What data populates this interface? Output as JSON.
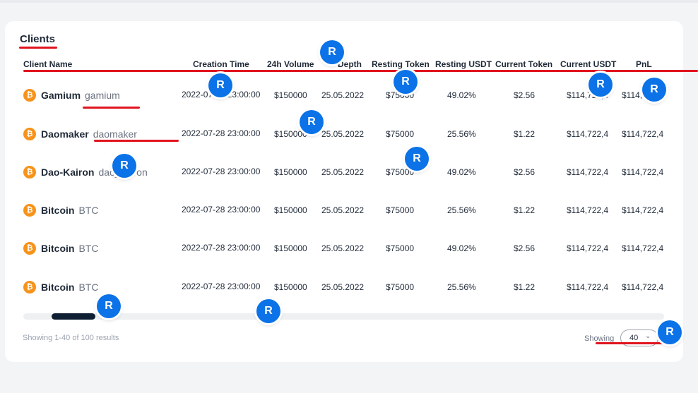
{
  "section": {
    "title": "Clients"
  },
  "columns": [
    "Client Name",
    "Creation Time",
    "24h Volume",
    "Depth",
    "Resting Token",
    "Resting USDT",
    "Current Token",
    "Current USDT",
    "PnL"
  ],
  "rows": [
    {
      "name": "Gamium",
      "symbol": "gamium",
      "created": "2022-07-28 23:00:00",
      "volume": "$150000",
      "depth": "25.05.2022",
      "resting_token": "$75000",
      "resting_usdt": "49.02%",
      "current_token": "$2.56",
      "current_usdt": "$114,722,4",
      "pnl": "$114,722,4"
    },
    {
      "name": "Daomaker",
      "symbol": "daomaker",
      "created": "2022-07-28 23:00:00",
      "volume": "$150000",
      "depth": "25.05.2022",
      "resting_token": "$75000",
      "resting_usdt": "25.56%",
      "current_token": "$1.22",
      "current_usdt": "$114,722,4",
      "pnl": "$114,722,4"
    },
    {
      "name": "Dao-Kairon",
      "symbol": "dao_kairon",
      "created": "2022-07-28 23:00:00",
      "volume": "$150000",
      "depth": "25.05.2022",
      "resting_token": "$75000",
      "resting_usdt": "49.02%",
      "current_token": "$2.56",
      "current_usdt": "$114,722,4",
      "pnl": "$114,722,4"
    },
    {
      "name": "Bitcoin",
      "symbol": "BTC",
      "created": "2022-07-28 23:00:00",
      "volume": "$150000",
      "depth": "25.05.2022",
      "resting_token": "$75000",
      "resting_usdt": "25.56%",
      "current_token": "$1.22",
      "current_usdt": "$114,722,4",
      "pnl": "$114,722,4"
    },
    {
      "name": "Bitcoin",
      "symbol": "BTC",
      "created": "2022-07-28 23:00:00",
      "volume": "$150000",
      "depth": "25.05.2022",
      "resting_token": "$75000",
      "resting_usdt": "49.02%",
      "current_token": "$2.56",
      "current_usdt": "$114,722,4",
      "pnl": "$114,722,4"
    },
    {
      "name": "Bitcoin",
      "symbol": "BTC",
      "created": "2022-07-28 23:00:00",
      "volume": "$150000",
      "depth": "25.05.2022",
      "resting_token": "$75000",
      "resting_usdt": "25.56%",
      "current_token": "$1.22",
      "current_usdt": "$114,722,4",
      "pnl": "$114,722,4"
    }
  ],
  "coin_icon": {
    "glyph": "₿",
    "icon": "bitcoin-icon",
    "color": "#f7931a"
  },
  "footer": {
    "results_text": "Showing 1-40 of 100 results",
    "showing_label": "Showing",
    "page_size": "40"
  },
  "overlay": {
    "marker_label": "R",
    "marker_color": "#0b72e7",
    "annotation_color": "#e0141e"
  },
  "colors": {
    "accent": "#0b72e7",
    "scroll_thumb": "#0f1f33"
  }
}
